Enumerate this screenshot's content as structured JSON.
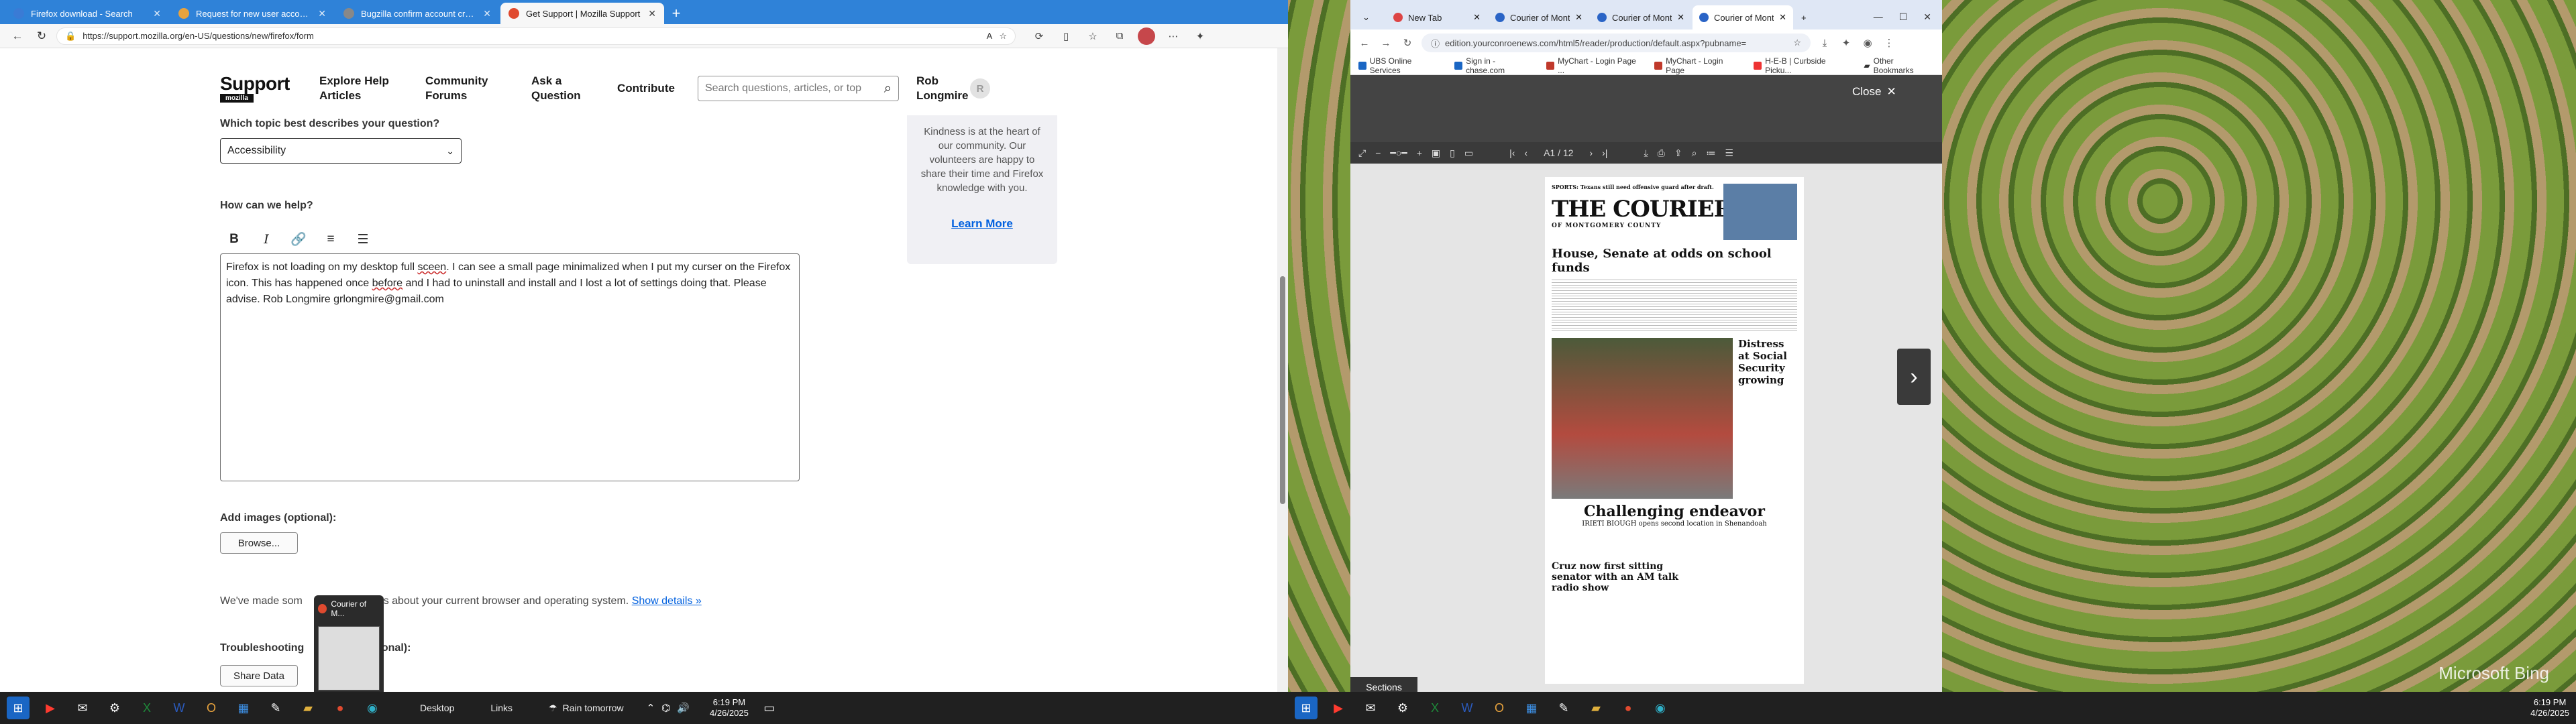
{
  "left": {
    "tabs": [
      {
        "title": "Firefox download - Search",
        "icon": "search-favicon",
        "color": "#3a7bd5"
      },
      {
        "title": "Request for new user account lis",
        "icon": "doc-favicon",
        "color": "#e8a33d"
      },
      {
        "title": "Bugzilla confirm account creatio",
        "icon": "bug-favicon",
        "color": "#888888"
      },
      {
        "title": "Get Support | Mozilla Support",
        "icon": "firefox-favicon",
        "color": "#e04a2f",
        "active": true
      }
    ],
    "url": "https://support.mozilla.org/en-US/questions/new/firefox/form",
    "site": {
      "logo_word": "Support",
      "logo_sub": "mozilla",
      "nav": [
        "Explore Help Articles",
        "Community Forums",
        "Ask a Question",
        "Contribute"
      ],
      "search_placeholder": "Search questions, articles, or top",
      "user": "Rob Longmire",
      "user_initial": "R"
    },
    "form": {
      "topic_label": "Which topic best describes your question?",
      "topic_value": "Accessibility",
      "help_label": "How can we help?",
      "body_pre": "Firefox is not loading on my desktop full ",
      "body_typo": "sceen",
      "body_mid": ".  I can see a small page minimalized when I put my curser on the Firefox icon.  This has happened once ",
      "body_typo2": "before",
      "body_post": " and I had to uninstall and install and I lost a lot of settings doing that.  Please advise.  Rob Longmire grlongmire@gmail.com",
      "images_label": "Add images (optional):",
      "browse": "Browse...",
      "made_some": "We've made som",
      "made_rest": "sses about your current browser and operating system.",
      "show_details": "Show details »",
      "troubleshoot_label": "Troubleshooting",
      "troubleshoot_rest": "ptional):",
      "share": "Share Data"
    },
    "sidecard": {
      "text": "Kindness is at the heart of our community. Our volunteers are happy to share their time and Firefox knowledge with you.",
      "link": "Learn More"
    },
    "popup_title": "Courier of M...",
    "taskbar": {
      "desktop": "Desktop",
      "links": "Links",
      "weather": "Rain tomorrow",
      "time": "6:19 PM",
      "date": "4/26/2025"
    }
  },
  "right": {
    "tabs": [
      {
        "title": "New Tab"
      },
      {
        "title": "Courier of Montg"
      },
      {
        "title": "Courier of Montg"
      },
      {
        "title": "Courier of Montg",
        "active": true
      }
    ],
    "url": "edition.yourconroenews.com/html5/reader/production/default.aspx?pubname=",
    "bookmarks": [
      "UBS Online Services",
      "Sign in - chase.com",
      "MyChart - Login Page ...",
      "MyChart - Login Page",
      "H-E-B | Curbside Picku..."
    ],
    "other_bookmarks": "Other Bookmarks",
    "close": "Close",
    "page_indicator": "A1 / 12",
    "paper": {
      "sports": "SPORTS: Texans still need offensive guard after draft.",
      "masthead": "THE COURIER",
      "masthead_sub": "OF MONTGOMERY COUNTY",
      "hl1": "House, Senate at odds on school funds",
      "side": "Distress at Social Security growing",
      "hl2": "Challenging endeavor",
      "hl2sub": "IRIETI BIOUGH opens second location in Shenandoah",
      "hl3": "Cruz now first sitting senator with an AM talk radio show"
    },
    "sections": "Sections",
    "watermark": "Microsoft Bing",
    "taskbar": {
      "time": "6:19 PM",
      "date": "4/26/2025"
    }
  }
}
